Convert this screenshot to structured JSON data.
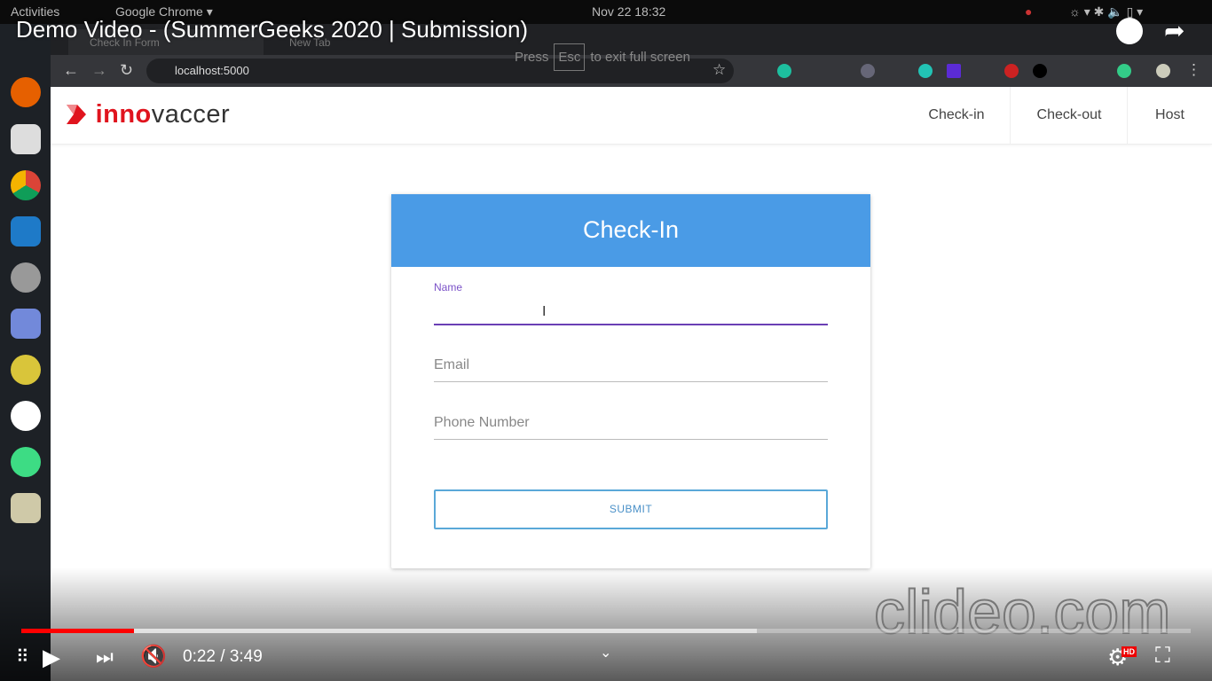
{
  "os": {
    "activities": "Activities",
    "app": "Google Chrome ▾",
    "clock": "Nov 22  18:32"
  },
  "browser": {
    "tabs": [
      "Check In Form",
      "New Tab"
    ],
    "url": "localhost:5000",
    "fullscreen_msg": {
      "press": "Press",
      "esc": "Esc",
      "rest": "to exit full screen"
    }
  },
  "site": {
    "logo": {
      "part1": "inno",
      "part2": "vaccer"
    },
    "nav": [
      "Check-in",
      "Check-out",
      "Host"
    ]
  },
  "form": {
    "title": "Check-In",
    "fields": [
      {
        "label": "Name",
        "value": "",
        "focused": true
      },
      {
        "label": "Email",
        "value": ""
      },
      {
        "label": "Phone Number",
        "value": ""
      }
    ],
    "submit": "SUBMIT"
  },
  "video": {
    "title": "Demo Video - (SummerGeeks 2020 | Submission)",
    "current": "0:22",
    "duration": "3:49",
    "time_display": "0:22 / 3:49",
    "played_percent": 9.6,
    "buffered_percent": 62.9,
    "muted": true,
    "quality_badge": "HD",
    "watermark": "clideo.com"
  },
  "colors": {
    "header": "#4a9be6",
    "focus": "#6a3fb5",
    "progress": "#ff0000",
    "brand": "#e0141e"
  }
}
